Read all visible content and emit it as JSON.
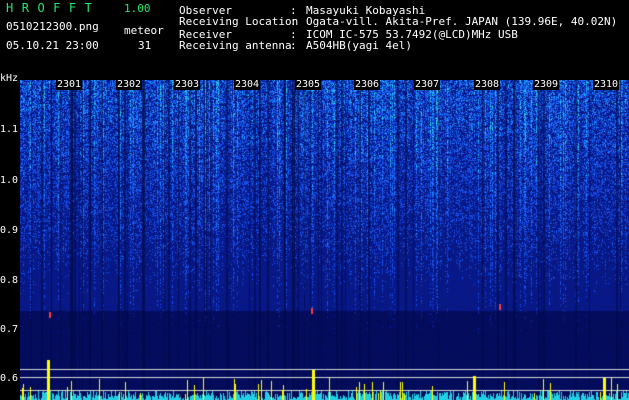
{
  "header": {
    "app_title": "HROFFT",
    "app_version": "1.00",
    "filename": "0510212300.png",
    "meteor_label": "meteor",
    "datetime": "05.10.21 23:00",
    "meteor_count": "31",
    "info": [
      {
        "key": "Observer",
        "value": "Masayuki Kobayashi"
      },
      {
        "key": "Receiving Location",
        "value": "Ogata-vill. Akita-Pref. JAPAN (139.96E, 40.02N)"
      },
      {
        "key": "Receiver",
        "value": "ICOM IC-575 53.7492(@LCD)MHz USB"
      },
      {
        "key": "Receiving antenna",
        "value": "A504HB(yagi 4el)"
      }
    ],
    "separator": ":"
  },
  "spectrogram": {
    "y_unit": "kHz",
    "y_ticks": [
      "1.1",
      "1.0",
      "0.9",
      "0.8",
      "0.7",
      "0.6"
    ],
    "x_ticks": [
      "2301",
      "2302",
      "2303",
      "2304",
      "2305",
      "2306",
      "2307",
      "2308",
      "2309",
      "2310"
    ],
    "colors": {
      "background": "#0a1e8c",
      "noise": "#1c5cff",
      "signal": "#27d3e8",
      "peak": "#ffff00",
      "meteor": "#ff3b3b",
      "text_green": "#22e86a"
    }
  }
}
